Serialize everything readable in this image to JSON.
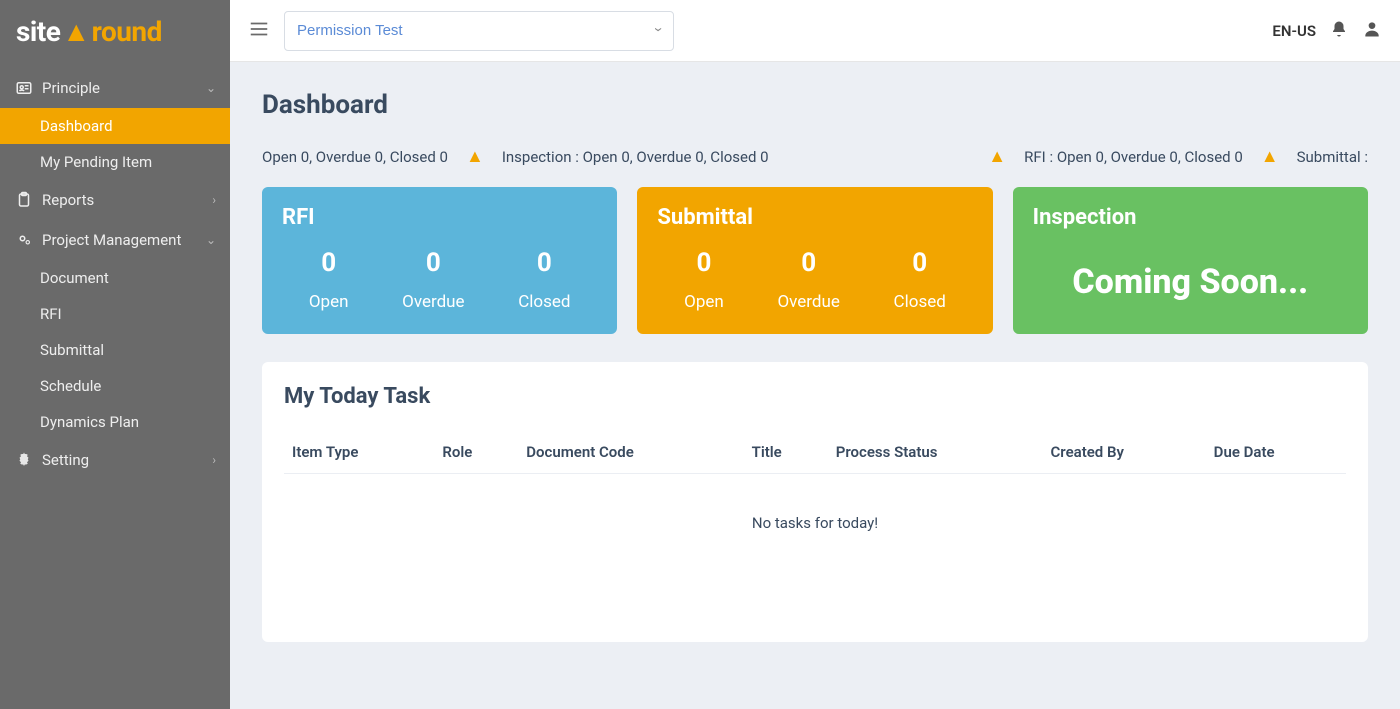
{
  "brand": {
    "part1": "site",
    "part2": "round"
  },
  "sidebar": {
    "groups": [
      {
        "label": "Principle",
        "icon": "id-card-icon",
        "expanded": true,
        "items": [
          {
            "label": "Dashboard",
            "active": true
          },
          {
            "label": "My Pending Item",
            "active": false
          }
        ]
      },
      {
        "label": "Reports",
        "icon": "clipboard-icon",
        "expanded": false,
        "items": []
      },
      {
        "label": "Project Management",
        "icon": "gears-icon",
        "expanded": true,
        "items": [
          {
            "label": "Document"
          },
          {
            "label": "RFI"
          },
          {
            "label": "Submittal"
          },
          {
            "label": "Schedule"
          },
          {
            "label": "Dynamics Plan"
          }
        ]
      },
      {
        "label": "Setting",
        "icon": "gear-icon",
        "expanded": false,
        "items": []
      }
    ]
  },
  "topbar": {
    "project_selected": "Permission Test",
    "language": "EN-US"
  },
  "page": {
    "title": "Dashboard",
    "ticker": {
      "left": "Open 0, Overdue 0, Closed 0",
      "inspection": "Inspection : Open 0, Overdue 0, Closed 0",
      "rfi": "RFI : Open 0, Overdue 0, Closed 0",
      "submittal": "Submittal :"
    },
    "cards": [
      {
        "title": "RFI",
        "color": "blue",
        "stats": [
          {
            "num": "0",
            "label": "Open"
          },
          {
            "num": "0",
            "label": "Overdue"
          },
          {
            "num": "0",
            "label": "Closed"
          }
        ]
      },
      {
        "title": "Submittal",
        "color": "orange",
        "stats": [
          {
            "num": "0",
            "label": "Open"
          },
          {
            "num": "0",
            "label": "Overdue"
          },
          {
            "num": "0",
            "label": "Closed"
          }
        ]
      },
      {
        "title": "Inspection",
        "color": "green",
        "coming": "Coming Soon..."
      }
    ],
    "task_panel": {
      "title": "My Today Task",
      "columns": [
        "Item Type",
        "Role",
        "Document Code",
        "Title",
        "Process Status",
        "Created By",
        "Due Date"
      ],
      "empty": "No tasks for today!"
    }
  },
  "chart_data": [
    {
      "type": "bar",
      "title": "RFI",
      "categories": [
        "Open",
        "Overdue",
        "Closed"
      ],
      "values": [
        0,
        0,
        0
      ]
    },
    {
      "type": "bar",
      "title": "Submittal",
      "categories": [
        "Open",
        "Overdue",
        "Closed"
      ],
      "values": [
        0,
        0,
        0
      ]
    }
  ]
}
